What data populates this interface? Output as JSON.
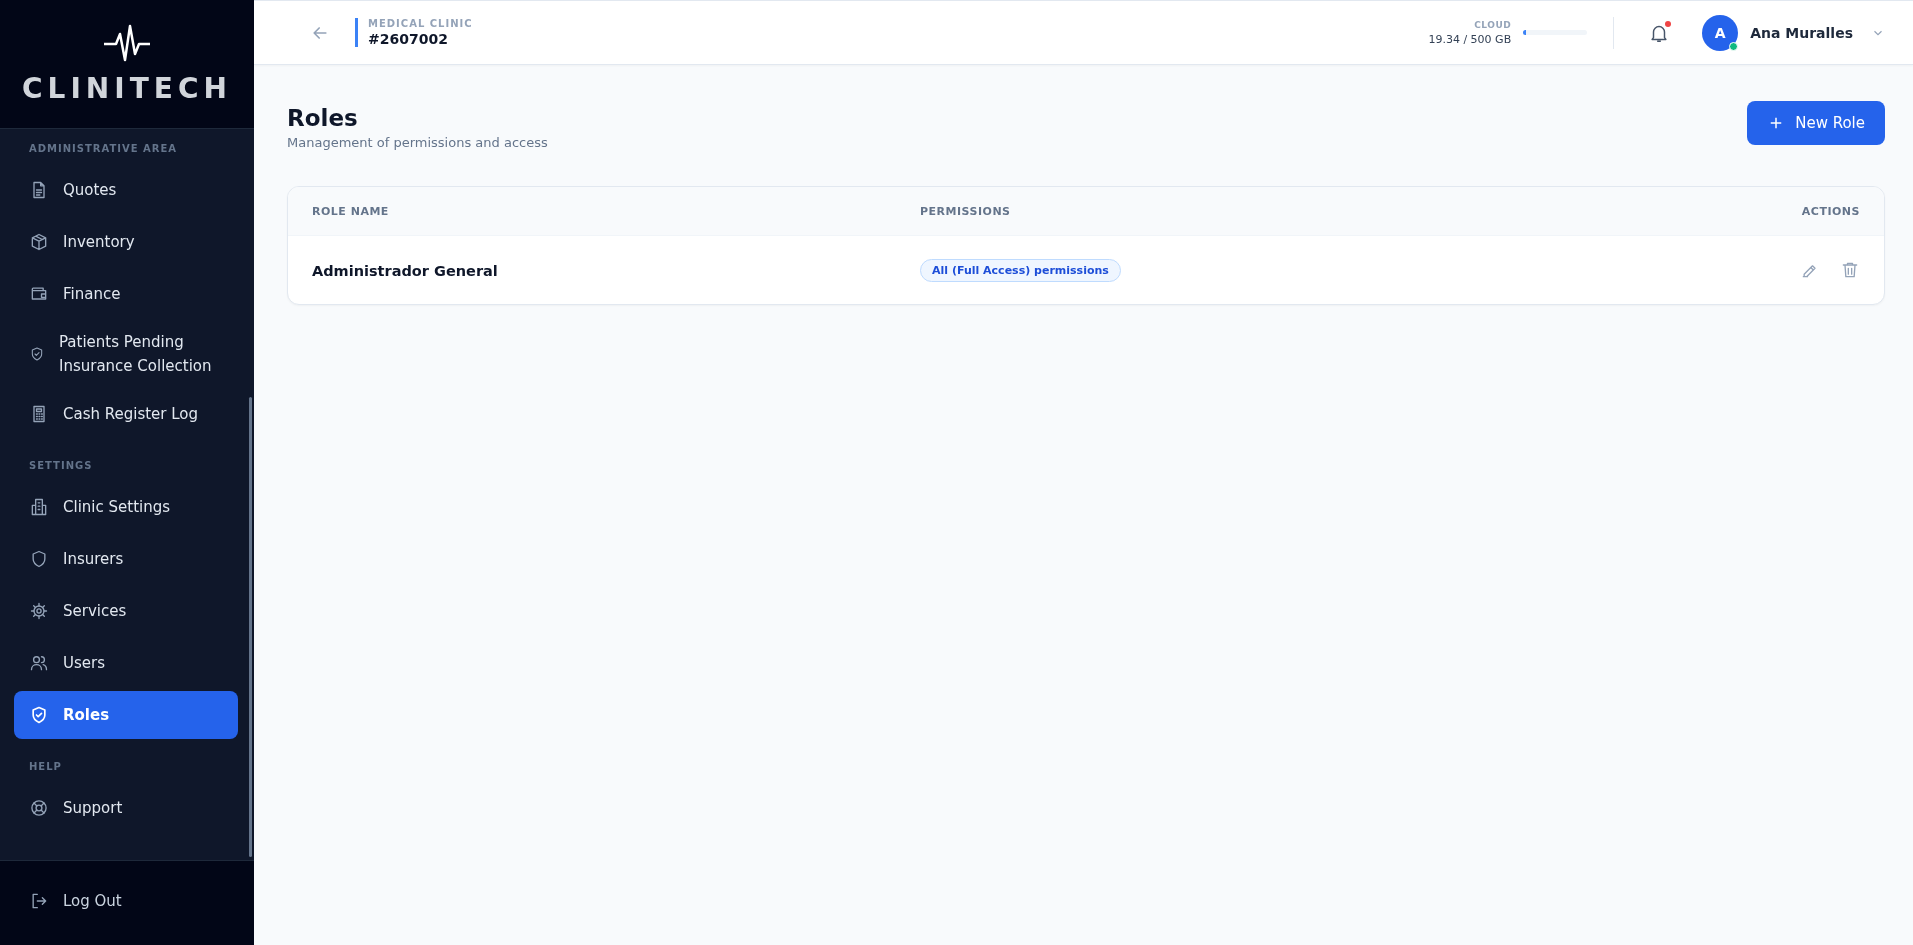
{
  "sidebar": {
    "logo": "CLINITECH",
    "sections": [
      {
        "title": "ADMINISTRATIVE AREA",
        "items": [
          {
            "label": "Quotes",
            "selected": false
          },
          {
            "label": "Inventory",
            "selected": false
          },
          {
            "label": "Finance",
            "selected": false
          },
          {
            "label": "Patients Pending Insurance Collection",
            "selected": false
          },
          {
            "label": "Cash Register Log",
            "selected": false
          }
        ]
      },
      {
        "title": "SETTINGS",
        "items": [
          {
            "label": "Clinic Settings",
            "selected": false
          },
          {
            "label": "Insurers",
            "selected": false
          },
          {
            "label": "Services",
            "selected": false
          },
          {
            "label": "Users",
            "selected": false
          },
          {
            "label": "Roles",
            "selected": true
          }
        ]
      },
      {
        "title": "HELP",
        "items": [
          {
            "label": "Support",
            "selected": false
          }
        ]
      }
    ],
    "logout": "Log Out"
  },
  "header": {
    "clinic_label": "MEDICAL CLINIC",
    "clinic_id": "#2607002",
    "storage": {
      "label": "CLOUD",
      "reading": "19.34 / 500 GB",
      "level": 0.04
    },
    "notifications": {
      "unread": true
    },
    "user": {
      "initial": "A",
      "name": "Ana Muralles",
      "online": true
    }
  },
  "page": {
    "title": "Roles",
    "subtitle": "Management of permissions and access",
    "new_button": "New Role"
  },
  "table": {
    "columns": [
      "ROLE NAME",
      "PERMISSIONS",
      "ACTIONS"
    ],
    "rows": [
      {
        "name": "Administrador General",
        "permissions": "All (Full Access) permissions"
      }
    ]
  }
}
